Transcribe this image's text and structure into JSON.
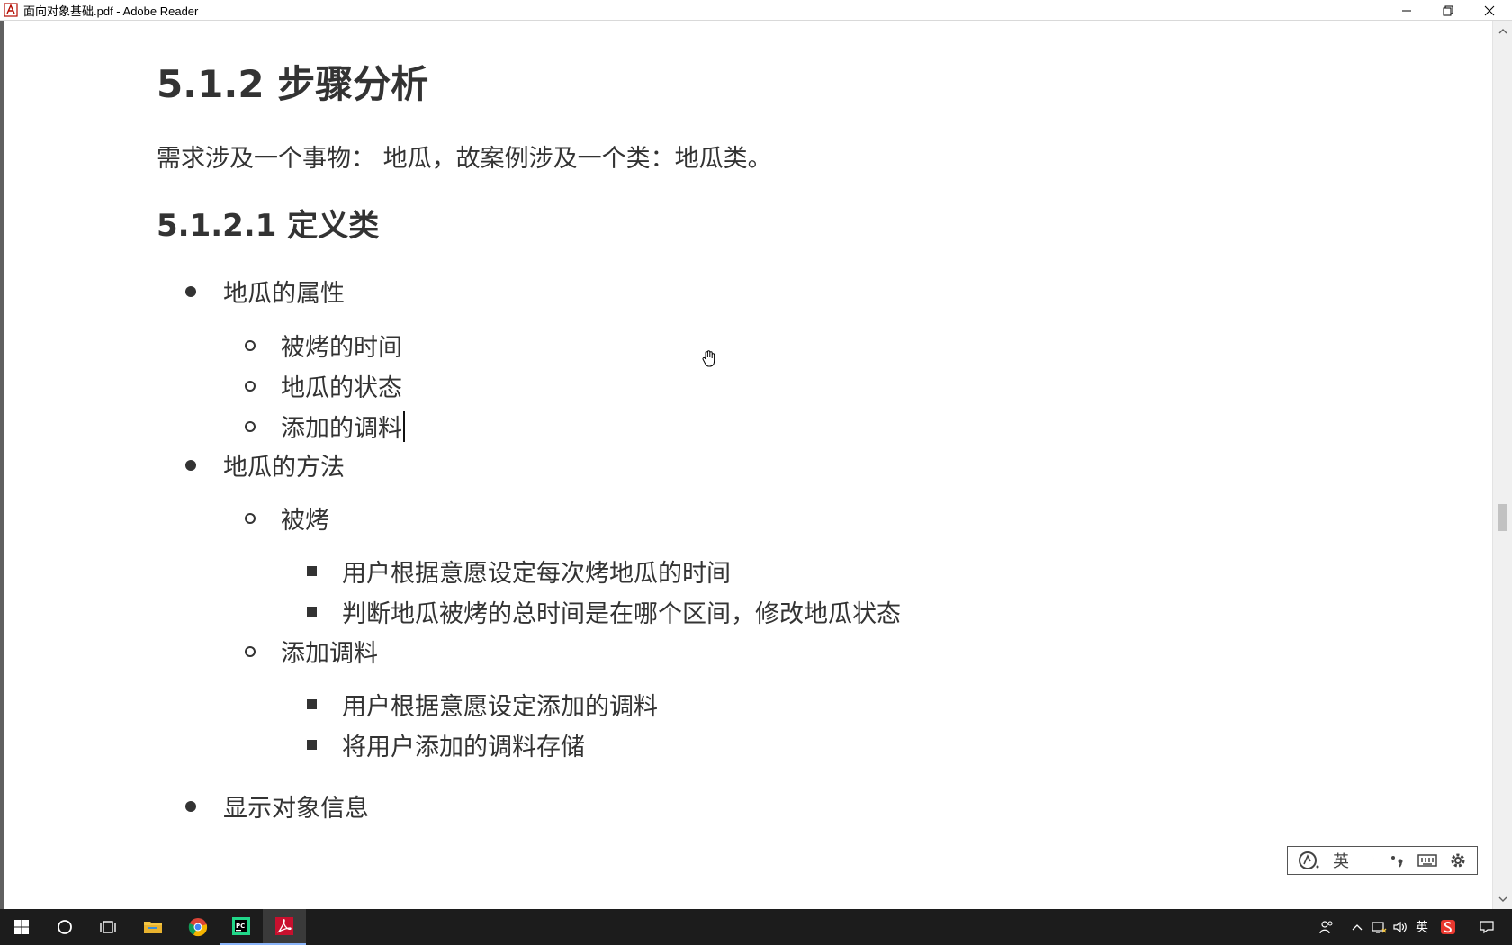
{
  "window": {
    "title": "面向对象基础.pdf - Adobe Reader"
  },
  "document": {
    "heading_main": "5.1.2 步骤分析",
    "paragraph": "需求涉及一个事物： 地瓜，故案例涉及一个类：地瓜类。",
    "heading_sub": "5.1.2.1 定义类",
    "list": {
      "attributes": "地瓜的属性",
      "attr_items": [
        "被烤的时间",
        "地瓜的状态",
        "添加的调料"
      ],
      "methods": "地瓜的方法",
      "method_bake": "被烤",
      "bake_items": [
        "用户根据意愿设定每次烤地瓜的时间",
        "判断地瓜被烤的总时间是在哪个区间，修改地瓜状态"
      ],
      "method_add": "添加调料",
      "add_items": [
        "用户根据意愿设定添加的调料",
        "将用户添加的调料存储"
      ],
      "display": "显示对象信息"
    }
  },
  "ime_toolbar": {
    "lang": "英"
  },
  "taskbar": {
    "tray_lang": "英"
  }
}
